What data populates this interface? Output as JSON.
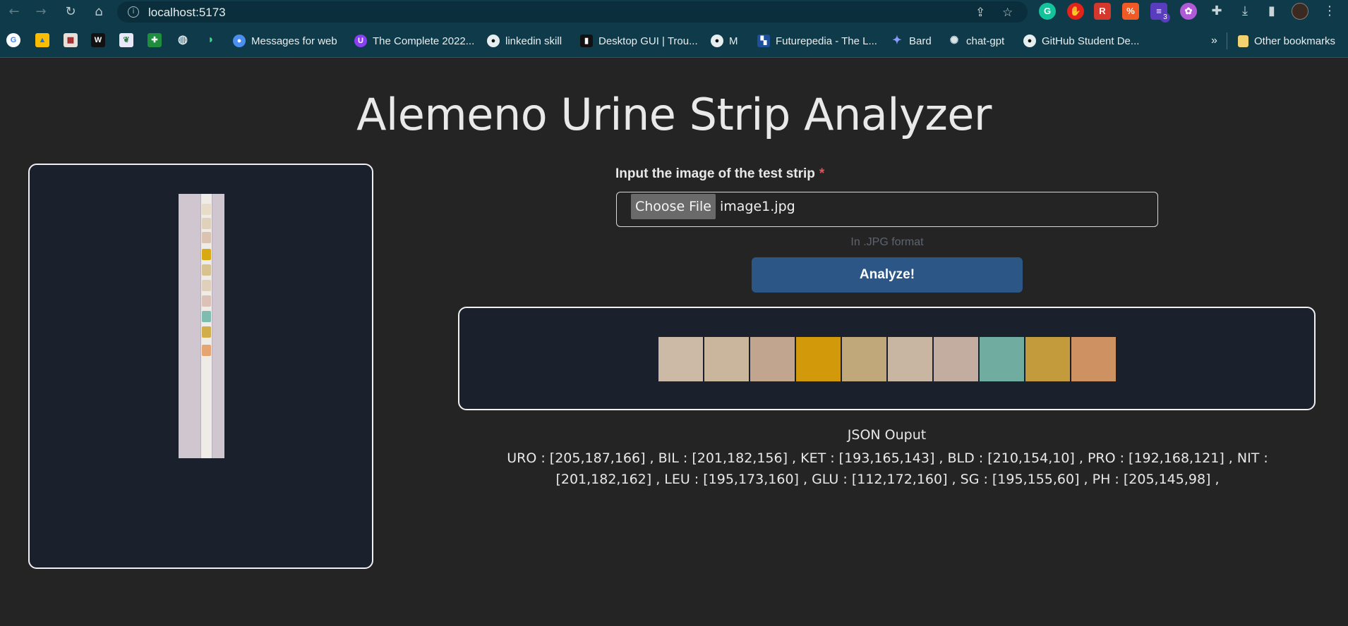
{
  "browser": {
    "url": "localhost:5173",
    "nav": {
      "back_glyph": "←",
      "forward_glyph": "→",
      "reload_glyph": "↻",
      "home_glyph": "⌂"
    },
    "extension_badge": "3",
    "bookmarks": [
      {
        "label": "Messages for web",
        "icon": "messages-icon",
        "color": "#4a8ff0"
      },
      {
        "label": "The Complete 2022...",
        "icon": "udemy-icon",
        "color": "#8a3ff0"
      },
      {
        "label": "linkedin skill",
        "icon": "github-icon",
        "color": "#222222"
      },
      {
        "label": "Desktop GUI | Trou...",
        "icon": "bookmark-page-icon",
        "color": "#111111"
      },
      {
        "label": "M",
        "icon": "github-icon",
        "color": "#222222"
      },
      {
        "label": "Futurepedia - The L...",
        "icon": "futurepedia-icon",
        "color": "#1d4f9a"
      },
      {
        "label": "Bard",
        "icon": "bard-icon",
        "color": "#6b7ff0"
      },
      {
        "label": "chat-gpt",
        "icon": "chatgpt-icon",
        "color": "#10a37f"
      },
      {
        "label": "GitHub Student De...",
        "icon": "github-icon",
        "color": "#222222"
      }
    ],
    "overflow_label": "»",
    "other_bookmarks_label": "Other bookmarks"
  },
  "page": {
    "title": "Alemeno Urine Strip Analyzer",
    "form": {
      "label": "Input the image of the test strip",
      "required_mark": "*",
      "choose_button": "Choose File",
      "file_name": "image1.jpg",
      "helper_text": "In .JPG format",
      "analyze_button": "Analyze!"
    },
    "swatch_colors": [
      "#cdbaa6",
      "#c9b69c",
      "#c1a58f",
      "#d29a0a",
      "#c0a87a",
      "#c9b6a2",
      "#c3ada0",
      "#70ac a0",
      "#c39b3c",
      "#cd9162"
    ],
    "json_title": "JSON Ouput",
    "json_output": "URO : [205,187,166] , BIL : [201,182,156] , KET : [193,165,143] , BLD : [210,154,10] , PRO : [192,168,121] , NIT : [201,182,162] , LEU : [195,173,160] , GLU : [112,172,160] , SG : [195,155,60] , PH : [205,145,98] ,"
  }
}
